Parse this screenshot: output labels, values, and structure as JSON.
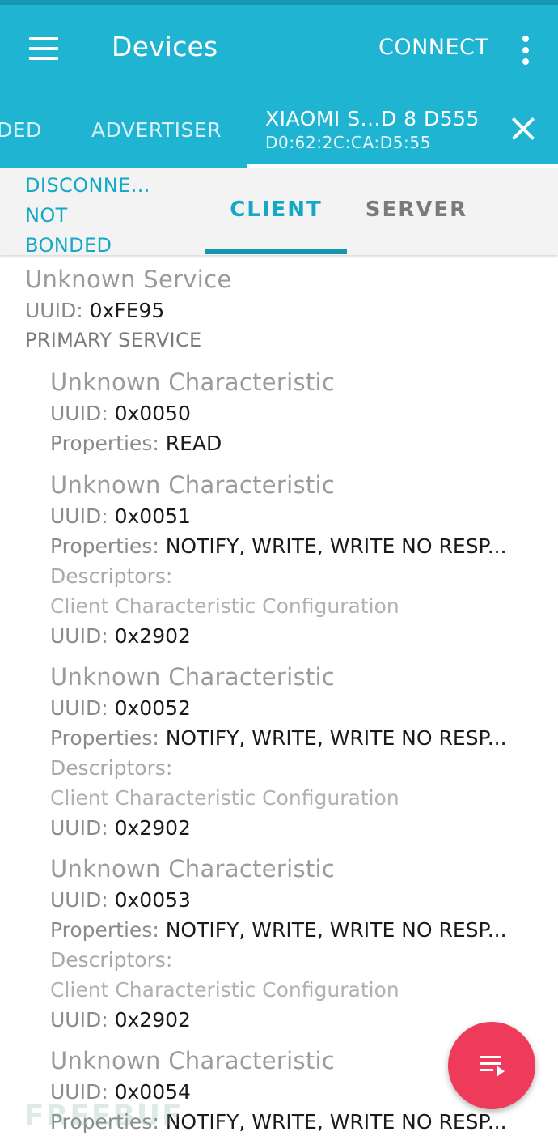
{
  "appbar": {
    "title": "Devices",
    "connect_label": "CONNECT",
    "menu_icon": "hamburger-menu-icon",
    "overflow_icon": "more-vert-icon",
    "bg_color": "#1eb4d2"
  },
  "device_tabs": {
    "bonded_label": "DED",
    "advertiser_label": "ADVERTISER",
    "active": {
      "name": "XIAOMI S...D 8 D555",
      "address": "D0:62:2C:CA:D5:55"
    },
    "close_icon": "close-icon"
  },
  "subbar": {
    "status_lines": [
      "DISCONNE...",
      "NOT",
      "BONDED"
    ],
    "tab_client": "CLIENT",
    "tab_server": "SERVER",
    "accent_color": "#13a8c6"
  },
  "service": {
    "name": "Unknown Service",
    "uuid_label": "UUID:",
    "uuid": "0xFE95",
    "type": "PRIMARY SERVICE"
  },
  "characteristics": [
    {
      "name": "Unknown Characteristic",
      "uuid_label": "UUID:",
      "uuid": "0x0050",
      "props_label": "Properties:",
      "props": "READ"
    },
    {
      "name": "Unknown Characteristic",
      "uuid_label": "UUID:",
      "uuid": "0x0051",
      "props_label": "Properties:",
      "props": "NOTIFY, WRITE, WRITE NO RESP...",
      "desc_label": "Descriptors:",
      "desc_name": "Client Characteristic Configuration",
      "desc_uuid_label": "UUID:",
      "desc_uuid": "0x2902"
    },
    {
      "name": "Unknown Characteristic",
      "uuid_label": "UUID:",
      "uuid": "0x0052",
      "props_label": "Properties:",
      "props": "NOTIFY, WRITE, WRITE NO RESP...",
      "desc_label": "Descriptors:",
      "desc_name": "Client Characteristic Configuration",
      "desc_uuid_label": "UUID:",
      "desc_uuid": "0x2902"
    },
    {
      "name": "Unknown Characteristic",
      "uuid_label": "UUID:",
      "uuid": "0x0053",
      "props_label": "Properties:",
      "props": "NOTIFY, WRITE, WRITE NO RESP...",
      "desc_label": "Descriptors:",
      "desc_name": "Client Characteristic Configuration",
      "desc_uuid_label": "UUID:",
      "desc_uuid": "0x2902"
    },
    {
      "name": "Unknown Characteristic",
      "uuid_label": "UUID:",
      "uuid": "0x0054",
      "props_label": "Properties:",
      "props": "NOTIFY, WRITE, WRITE NO RESP..."
    }
  ],
  "fab": {
    "icon": "playlist-play-icon",
    "color": "#ee3b5b"
  },
  "watermark": "FREEBUF"
}
